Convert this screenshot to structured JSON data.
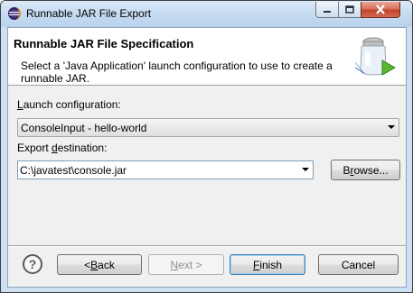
{
  "window": {
    "title": "Runnable JAR File Export",
    "controls": {
      "minimize_icon": "minimize-icon",
      "maximize_icon": "maximize-icon",
      "close_icon": "close-icon"
    }
  },
  "banner": {
    "title": "Runnable JAR File Specification",
    "description": "Select a 'Java Application' launch configuration to use to create a runnable JAR.",
    "graphic_icon": "jar-wizard-icon"
  },
  "launch": {
    "label_mnemonic": "L",
    "label_rest": "aunch configuration:",
    "value": "ConsoleInput - hello-world"
  },
  "export": {
    "label_pre": "Export ",
    "label_mnemonic": "d",
    "label_post": "estination:",
    "value": "C:\\javatest\\console.jar",
    "browse_pre": "B",
    "browse_mnemonic": "r",
    "browse_post": "owse..."
  },
  "footer": {
    "help_glyph": "?",
    "back_pre": "< ",
    "back_mnemonic": "B",
    "back_post": "ack",
    "next_pre": "",
    "next_mnemonic": "N",
    "next_post": "ext >",
    "finish_pre": "",
    "finish_mnemonic": "F",
    "finish_post": "inish",
    "cancel_label": "Cancel"
  },
  "colors": {
    "accent": "#3c7fb1",
    "banner_bg": "#ffffff",
    "dialog_bg": "#f0f0f0"
  }
}
